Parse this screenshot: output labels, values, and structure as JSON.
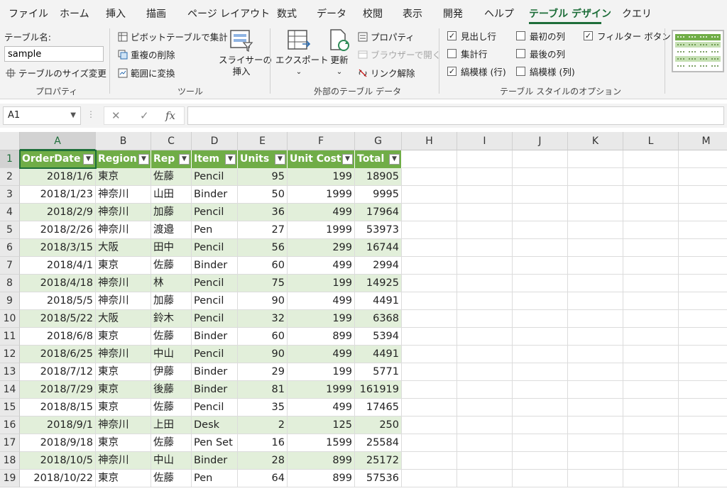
{
  "tabs": [
    {
      "label": "ファイル",
      "active": false
    },
    {
      "label": "ホーム",
      "active": false
    },
    {
      "label": "挿入",
      "active": false
    },
    {
      "label": "描画",
      "active": false
    },
    {
      "label": "ページ レイアウト",
      "active": false
    },
    {
      "label": "数式",
      "active": false
    },
    {
      "label": "データ",
      "active": false
    },
    {
      "label": "校閲",
      "active": false
    },
    {
      "label": "表示",
      "active": false
    },
    {
      "label": "開発",
      "active": false
    },
    {
      "label": "ヘルプ",
      "active": false
    },
    {
      "label": "テーブル デザイン",
      "active": true
    },
    {
      "label": "クエリ",
      "active": false
    }
  ],
  "ribbon": {
    "properties": {
      "table_name_label": "テーブル名:",
      "table_name_value": "sample",
      "resize_label": "テーブルのサイズ変更",
      "group_label": "プロパティ"
    },
    "tools": {
      "pivot_label": "ピボットテーブルで集計",
      "remove_dup_label": "重複の削除",
      "convert_label": "範囲に変換",
      "slicer_label_1": "スライサーの",
      "slicer_label_2": "挿入",
      "group_label": "ツール"
    },
    "external": {
      "export_label": "エクスポート",
      "refresh_label": "更新",
      "properties_label": "プロパティ",
      "browser_label": "ブラウザーで開く",
      "unlink_label": "リンク解除",
      "group_label": "外部のテーブル データ"
    },
    "style_options": {
      "header_row": {
        "label": "見出し行",
        "checked": true
      },
      "total_row": {
        "label": "集計行",
        "checked": false
      },
      "banded_rows": {
        "label": "縞模様 (行)",
        "checked": true
      },
      "first_column": {
        "label": "最初の列",
        "checked": false
      },
      "last_column": {
        "label": "最後の列",
        "checked": false
      },
      "banded_columns": {
        "label": "縞模様 (列)",
        "checked": false
      },
      "filter_button": {
        "label": "フィルター ボタン",
        "checked": true
      },
      "group_label": "テーブル スタイルのオプション"
    }
  },
  "formula_bar": {
    "name_box": "A1",
    "cancel_icon": "✕",
    "enter_icon": "✓",
    "fx_label": "fx",
    "formula": ""
  },
  "grid": {
    "columns": [
      "A",
      "B",
      "C",
      "D",
      "E",
      "F",
      "G",
      "H",
      "I",
      "J",
      "K",
      "L",
      "M"
    ],
    "table_headers": [
      "OrderDate",
      "Region",
      "Rep",
      "Item",
      "Units",
      "Unit Cost",
      "Total"
    ],
    "rows": [
      [
        "2018/1/6",
        "東京",
        "佐藤",
        "Pencil",
        "95",
        "199",
        "18905"
      ],
      [
        "2018/1/23",
        "神奈川",
        "山田",
        "Binder",
        "50",
        "1999",
        "9995"
      ],
      [
        "2018/2/9",
        "神奈川",
        "加藤",
        "Pencil",
        "36",
        "499",
        "17964"
      ],
      [
        "2018/2/26",
        "神奈川",
        "渡邉",
        "Pen",
        "27",
        "1999",
        "53973"
      ],
      [
        "2018/3/15",
        "大阪",
        "田中",
        "Pencil",
        "56",
        "299",
        "16744"
      ],
      [
        "2018/4/1",
        "東京",
        "佐藤",
        "Binder",
        "60",
        "499",
        "2994"
      ],
      [
        "2018/4/18",
        "神奈川",
        "林",
        "Pencil",
        "75",
        "199",
        "14925"
      ],
      [
        "2018/5/5",
        "神奈川",
        "加藤",
        "Pencil",
        "90",
        "499",
        "4491"
      ],
      [
        "2018/5/22",
        "大阪",
        "鈴木",
        "Pencil",
        "32",
        "199",
        "6368"
      ],
      [
        "2018/6/8",
        "東京",
        "佐藤",
        "Binder",
        "60",
        "899",
        "5394"
      ],
      [
        "2018/6/25",
        "神奈川",
        "中山",
        "Pencil",
        "90",
        "499",
        "4491"
      ],
      [
        "2018/7/12",
        "東京",
        "伊藤",
        "Binder",
        "29",
        "199",
        "5771"
      ],
      [
        "2018/7/29",
        "東京",
        "後藤",
        "Binder",
        "81",
        "1999",
        "161919"
      ],
      [
        "2018/8/15",
        "東京",
        "佐藤",
        "Pencil",
        "35",
        "499",
        "17465"
      ],
      [
        "2018/9/1",
        "神奈川",
        "上田",
        "Desk",
        "2",
        "125",
        "250"
      ],
      [
        "2018/9/18",
        "東京",
        "佐藤",
        "Pen Set",
        "16",
        "1599",
        "25584"
      ],
      [
        "2018/10/5",
        "神奈川",
        "中山",
        "Binder",
        "28",
        "899",
        "25172"
      ],
      [
        "2018/10/22",
        "東京",
        "佐藤",
        "Pen",
        "64",
        "899",
        "57536"
      ]
    ]
  },
  "colors": {
    "accent": "#1e6e3a",
    "table_header": "#70ad47",
    "band": "#e2efda"
  }
}
